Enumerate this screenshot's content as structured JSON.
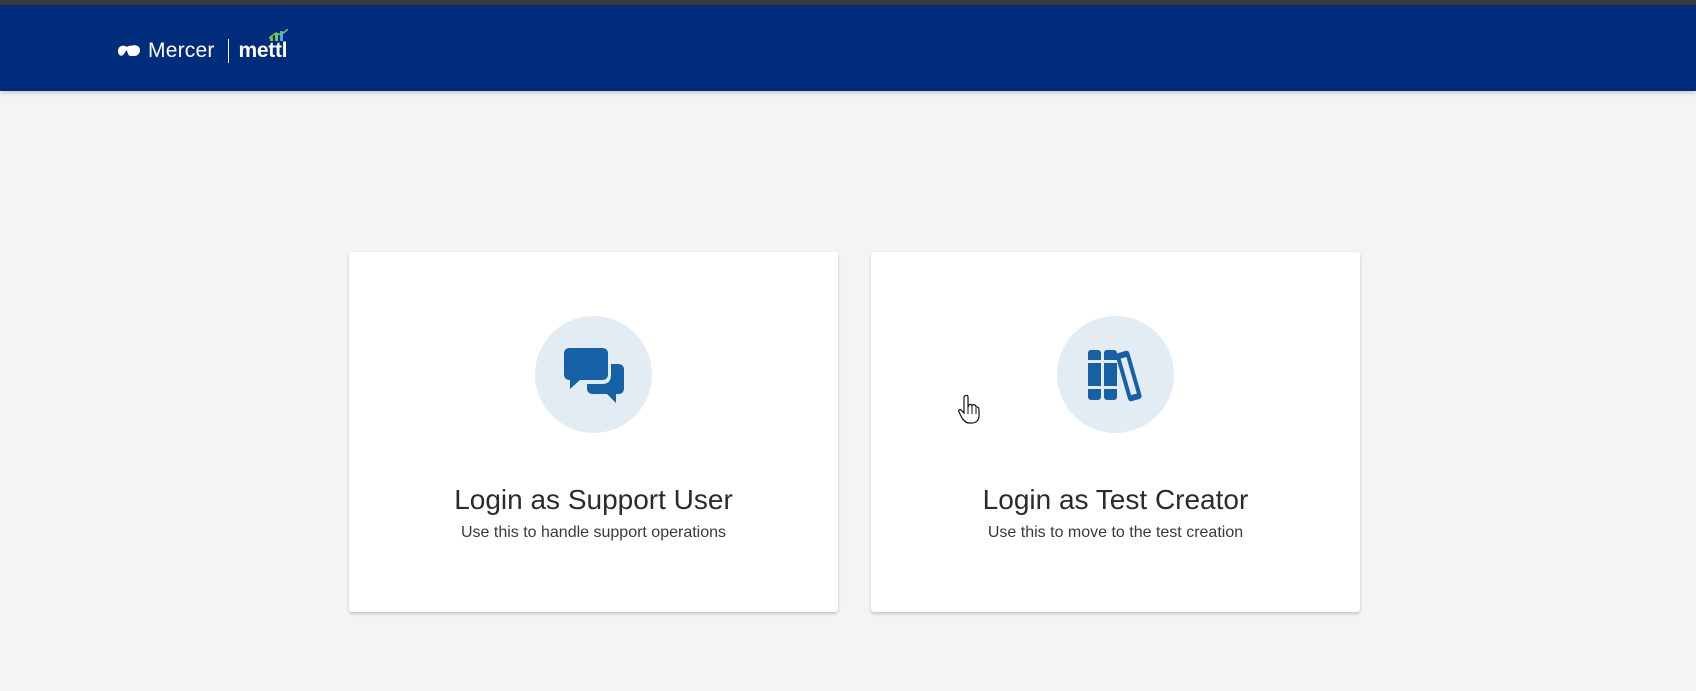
{
  "header": {
    "brand_primary": "Mercer",
    "brand_secondary": "mettl",
    "background_color": "#002c7c"
  },
  "cards": [
    {
      "title": "Login as Support User",
      "subtitle": "Use this to handle support operations",
      "icon": "chat-bubbles-icon"
    },
    {
      "title": "Login as Test Creator",
      "subtitle": "Use this to move to the test creation",
      "icon": "books-icon"
    }
  ],
  "colors": {
    "accent_icon": "#1660a6",
    "icon_circle": "#e3ecf3",
    "page_background": "#f4f4f5"
  }
}
